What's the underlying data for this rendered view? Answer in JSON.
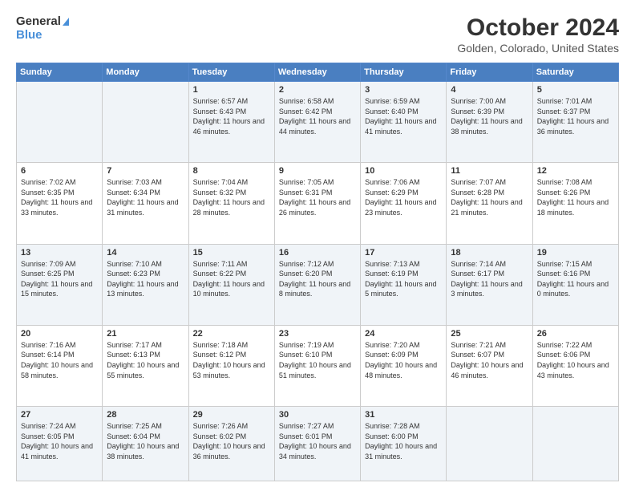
{
  "header": {
    "logo_general": "General",
    "logo_blue": "Blue",
    "title": "October 2024",
    "location": "Golden, Colorado, United States"
  },
  "days_of_week": [
    "Sunday",
    "Monday",
    "Tuesday",
    "Wednesday",
    "Thursday",
    "Friday",
    "Saturday"
  ],
  "weeks": [
    [
      {
        "day": "",
        "detail": ""
      },
      {
        "day": "",
        "detail": ""
      },
      {
        "day": "1",
        "detail": "Sunrise: 6:57 AM\nSunset: 6:43 PM\nDaylight: 11 hours and 46 minutes."
      },
      {
        "day": "2",
        "detail": "Sunrise: 6:58 AM\nSunset: 6:42 PM\nDaylight: 11 hours and 44 minutes."
      },
      {
        "day": "3",
        "detail": "Sunrise: 6:59 AM\nSunset: 6:40 PM\nDaylight: 11 hours and 41 minutes."
      },
      {
        "day": "4",
        "detail": "Sunrise: 7:00 AM\nSunset: 6:39 PM\nDaylight: 11 hours and 38 minutes."
      },
      {
        "day": "5",
        "detail": "Sunrise: 7:01 AM\nSunset: 6:37 PM\nDaylight: 11 hours and 36 minutes."
      }
    ],
    [
      {
        "day": "6",
        "detail": "Sunrise: 7:02 AM\nSunset: 6:35 PM\nDaylight: 11 hours and 33 minutes."
      },
      {
        "day": "7",
        "detail": "Sunrise: 7:03 AM\nSunset: 6:34 PM\nDaylight: 11 hours and 31 minutes."
      },
      {
        "day": "8",
        "detail": "Sunrise: 7:04 AM\nSunset: 6:32 PM\nDaylight: 11 hours and 28 minutes."
      },
      {
        "day": "9",
        "detail": "Sunrise: 7:05 AM\nSunset: 6:31 PM\nDaylight: 11 hours and 26 minutes."
      },
      {
        "day": "10",
        "detail": "Sunrise: 7:06 AM\nSunset: 6:29 PM\nDaylight: 11 hours and 23 minutes."
      },
      {
        "day": "11",
        "detail": "Sunrise: 7:07 AM\nSunset: 6:28 PM\nDaylight: 11 hours and 21 minutes."
      },
      {
        "day": "12",
        "detail": "Sunrise: 7:08 AM\nSunset: 6:26 PM\nDaylight: 11 hours and 18 minutes."
      }
    ],
    [
      {
        "day": "13",
        "detail": "Sunrise: 7:09 AM\nSunset: 6:25 PM\nDaylight: 11 hours and 15 minutes."
      },
      {
        "day": "14",
        "detail": "Sunrise: 7:10 AM\nSunset: 6:23 PM\nDaylight: 11 hours and 13 minutes."
      },
      {
        "day": "15",
        "detail": "Sunrise: 7:11 AM\nSunset: 6:22 PM\nDaylight: 11 hours and 10 minutes."
      },
      {
        "day": "16",
        "detail": "Sunrise: 7:12 AM\nSunset: 6:20 PM\nDaylight: 11 hours and 8 minutes."
      },
      {
        "day": "17",
        "detail": "Sunrise: 7:13 AM\nSunset: 6:19 PM\nDaylight: 11 hours and 5 minutes."
      },
      {
        "day": "18",
        "detail": "Sunrise: 7:14 AM\nSunset: 6:17 PM\nDaylight: 11 hours and 3 minutes."
      },
      {
        "day": "19",
        "detail": "Sunrise: 7:15 AM\nSunset: 6:16 PM\nDaylight: 11 hours and 0 minutes."
      }
    ],
    [
      {
        "day": "20",
        "detail": "Sunrise: 7:16 AM\nSunset: 6:14 PM\nDaylight: 10 hours and 58 minutes."
      },
      {
        "day": "21",
        "detail": "Sunrise: 7:17 AM\nSunset: 6:13 PM\nDaylight: 10 hours and 55 minutes."
      },
      {
        "day": "22",
        "detail": "Sunrise: 7:18 AM\nSunset: 6:12 PM\nDaylight: 10 hours and 53 minutes."
      },
      {
        "day": "23",
        "detail": "Sunrise: 7:19 AM\nSunset: 6:10 PM\nDaylight: 10 hours and 51 minutes."
      },
      {
        "day": "24",
        "detail": "Sunrise: 7:20 AM\nSunset: 6:09 PM\nDaylight: 10 hours and 48 minutes."
      },
      {
        "day": "25",
        "detail": "Sunrise: 7:21 AM\nSunset: 6:07 PM\nDaylight: 10 hours and 46 minutes."
      },
      {
        "day": "26",
        "detail": "Sunrise: 7:22 AM\nSunset: 6:06 PM\nDaylight: 10 hours and 43 minutes."
      }
    ],
    [
      {
        "day": "27",
        "detail": "Sunrise: 7:24 AM\nSunset: 6:05 PM\nDaylight: 10 hours and 41 minutes."
      },
      {
        "day": "28",
        "detail": "Sunrise: 7:25 AM\nSunset: 6:04 PM\nDaylight: 10 hours and 38 minutes."
      },
      {
        "day": "29",
        "detail": "Sunrise: 7:26 AM\nSunset: 6:02 PM\nDaylight: 10 hours and 36 minutes."
      },
      {
        "day": "30",
        "detail": "Sunrise: 7:27 AM\nSunset: 6:01 PM\nDaylight: 10 hours and 34 minutes."
      },
      {
        "day": "31",
        "detail": "Sunrise: 7:28 AM\nSunset: 6:00 PM\nDaylight: 10 hours and 31 minutes."
      },
      {
        "day": "",
        "detail": ""
      },
      {
        "day": "",
        "detail": ""
      }
    ]
  ]
}
